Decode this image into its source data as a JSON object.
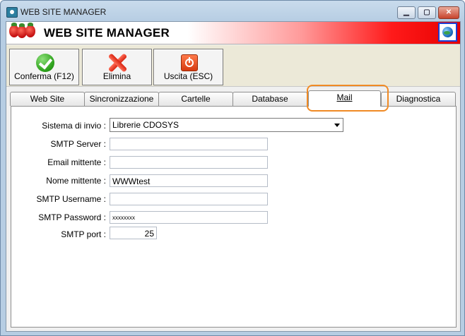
{
  "window": {
    "title": "WEB SITE MANAGER",
    "controls": {
      "minimize": "▁",
      "maximize": "▢",
      "close": "✕"
    }
  },
  "header": {
    "title": "WEB SITE MANAGER",
    "right_icon": "globe-icon"
  },
  "toolbar": {
    "buttons": [
      {
        "label": "Conferma (F12)",
        "icon": "check-icon"
      },
      {
        "label": "Elimina",
        "icon": "delete-x-icon"
      },
      {
        "label": "Uscita (ESC)",
        "icon": "power-icon"
      }
    ]
  },
  "tabs": [
    {
      "label": "Web Site"
    },
    {
      "label": "Sincronizzazione"
    },
    {
      "label": "Cartelle"
    },
    {
      "label": "Database"
    },
    {
      "label": "Mail",
      "active": true
    },
    {
      "label": "Diagnostica"
    }
  ],
  "form": {
    "sistema_label": "Sistema di invio :",
    "sistema_value": "Librerie CDOSYS",
    "smtp_server_label": "SMTP Server :",
    "smtp_server_value": "",
    "email_label": "Email mittente :",
    "email_value": "",
    "nome_label": "Nome mittente :",
    "nome_value": "WWWtest",
    "username_label": "SMTP Username :",
    "username_value": "",
    "password_label": "SMTP Password :",
    "password_value": "xxxxxxxx",
    "port_label": "SMTP port :",
    "port_value": "25"
  },
  "colors": {
    "accent_highlight": "#f08a24",
    "header_red": "#e60000",
    "globe_border": "#1a3fd6"
  }
}
